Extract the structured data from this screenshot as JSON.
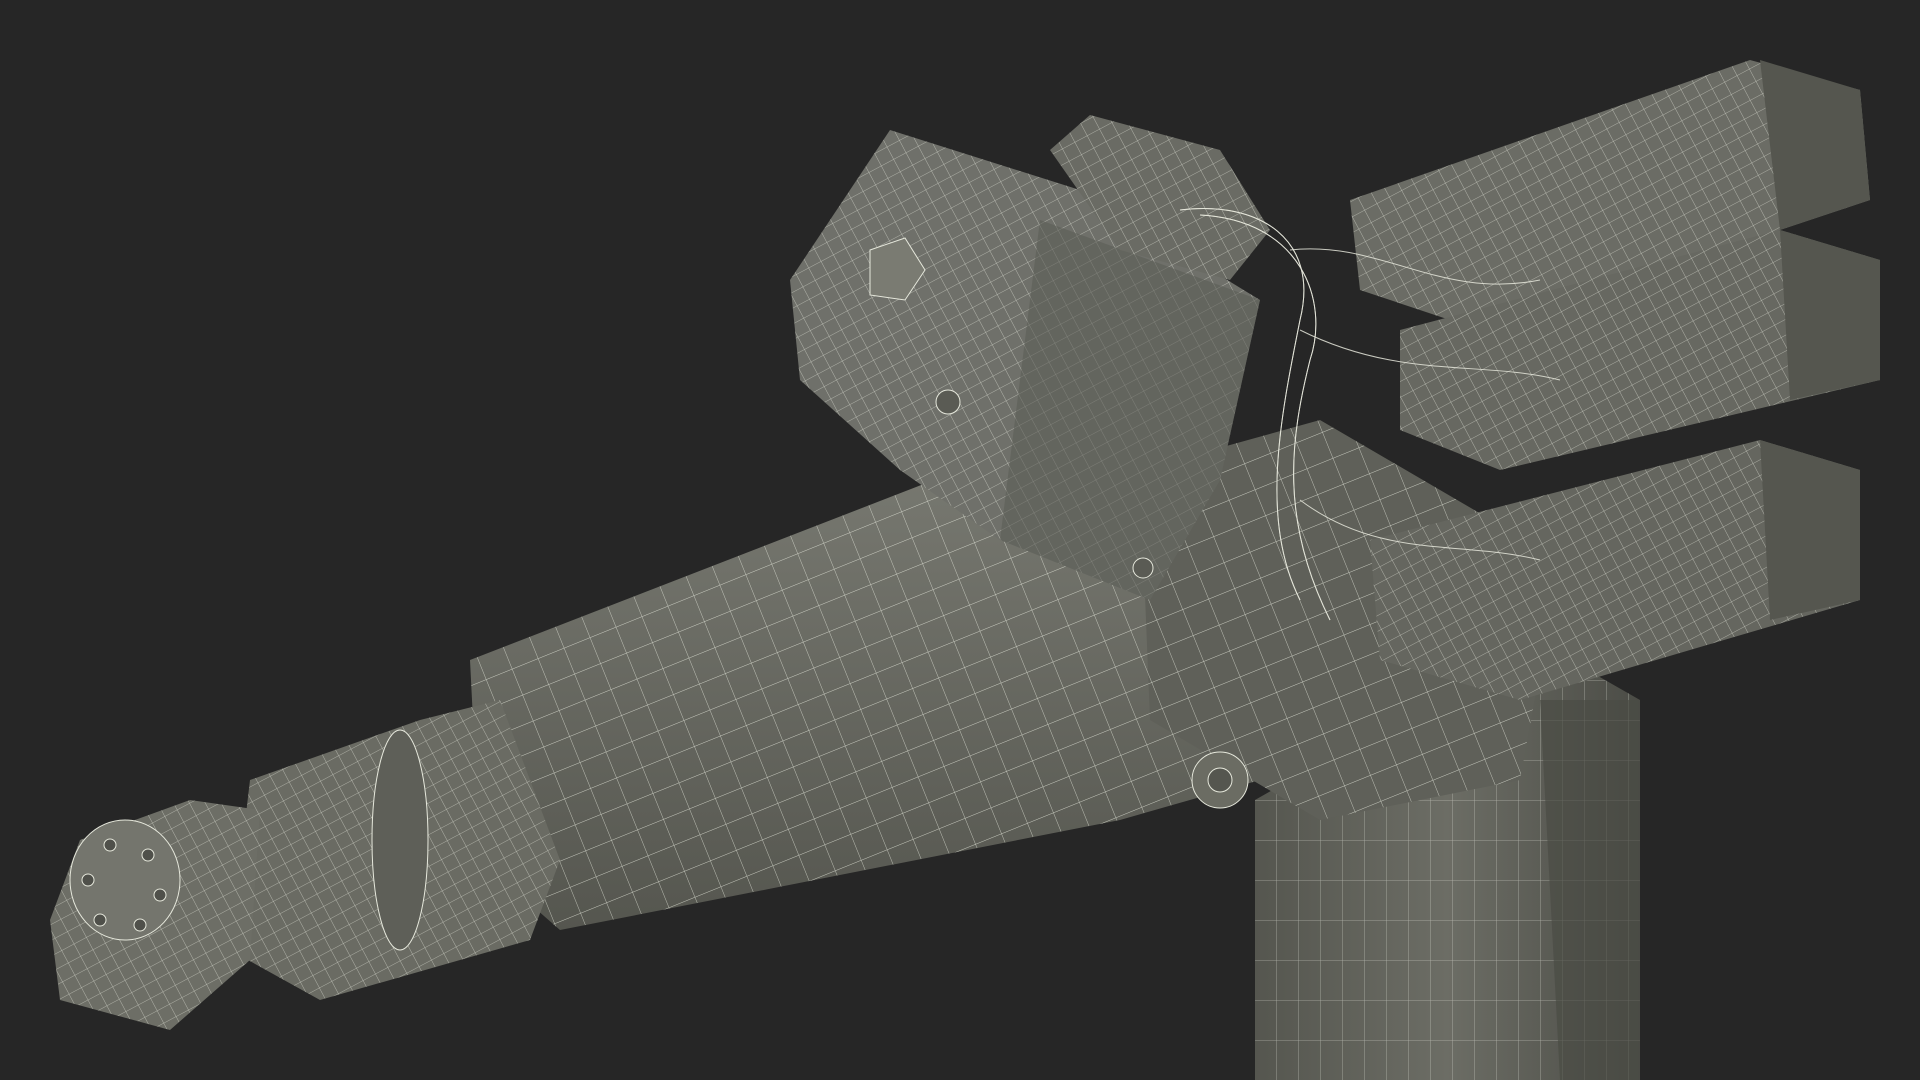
{
  "scene": {
    "subject": "robot-arm-wireframe",
    "background_color": "#262626",
    "mesh_color": "#6b6c63",
    "mesh_shadow_color": "#4a4b44",
    "wire_color": "#e6e8dc"
  }
}
